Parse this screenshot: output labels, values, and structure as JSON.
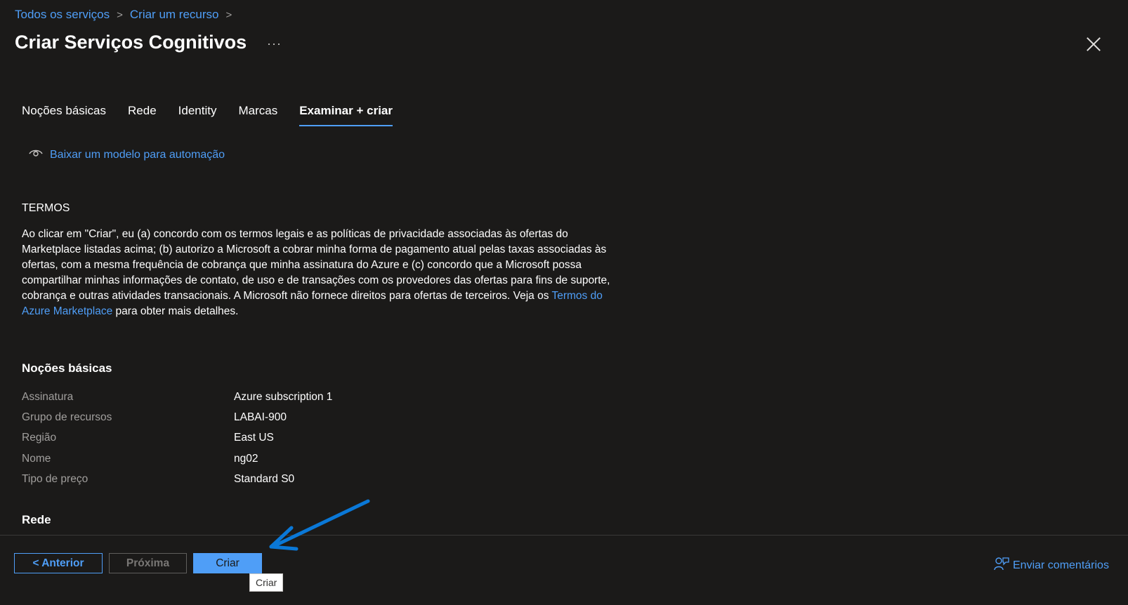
{
  "breadcrumb": {
    "item1": "Todos os serviços",
    "item2": "Criar um recurso"
  },
  "header": {
    "title": "Criar Serviços Cognitivos",
    "more": "···"
  },
  "tabs": [
    {
      "label": "Noções básicas"
    },
    {
      "label": "Rede"
    },
    {
      "label": "Identity"
    },
    {
      "label": "Marcas"
    },
    {
      "label": "Examinar + criar",
      "active": true
    }
  ],
  "download_link": "Baixar um modelo para automação",
  "terms": {
    "heading": "TERMOS",
    "text_before": "Ao clicar em \"Criar\", eu (a) concordo com os termos legais e as políticas de privacidade associadas às ofertas do Marketplace listadas acima; (b) autorizo a Microsoft a cobrar minha forma de pagamento atual pelas taxas associadas às ofertas, com a mesma frequência de cobrança que minha assinatura do Azure e (c) concordo que a Microsoft possa compartilhar minhas informações de contato, de uso e de transações com os provedores das ofertas para fins de suporte, cobrança e outras atividades transacionais. A Microsoft não fornece direitos para ofertas de terceiros. Veja os ",
    "link": "Termos do Azure Marketplace",
    "text_after": " para obter mais detalhes."
  },
  "basics": {
    "heading": "Noções básicas",
    "rows": [
      {
        "key": "Assinatura",
        "value": "Azure subscription 1"
      },
      {
        "key": "Grupo de recursos",
        "value": "LABAI-900"
      },
      {
        "key": "Região",
        "value": "East US"
      },
      {
        "key": "Nome",
        "value": "ng02"
      },
      {
        "key": "Tipo de preço",
        "value": "Standard S0"
      }
    ]
  },
  "network": {
    "heading": "Rede"
  },
  "footer": {
    "prev": "< Anterior",
    "next": "Próxima",
    "create": "Criar",
    "tooltip": "Criar",
    "feedback": "Enviar comentários"
  },
  "colors": {
    "accent": "#4f9ef7",
    "background": "#1b1a19",
    "annotation_arrow": "#0a78d7"
  }
}
